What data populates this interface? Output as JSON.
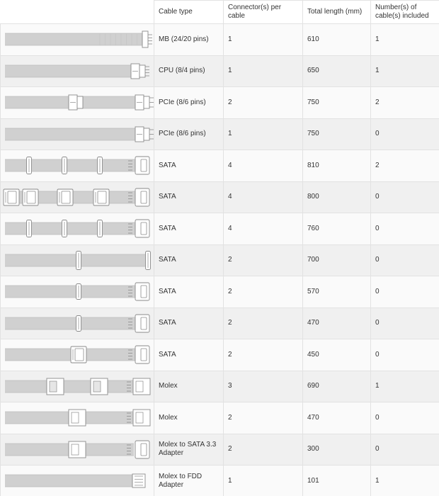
{
  "header": {
    "cable_type": "Cable type",
    "connectors": "Connector(s) per cable",
    "length": "Total length (mm)",
    "included": "Number(s) of cable(s) included"
  },
  "rows": [
    {
      "type": "MB (24/20 pins)",
      "connectors": "1",
      "length": "610",
      "included": "1",
      "diagram": "mb-cable-icon"
    },
    {
      "type": "CPU (8/4 pins)",
      "connectors": "1",
      "length": "650",
      "included": "1",
      "diagram": "cpu-cable-icon"
    },
    {
      "type": "PCIe (8/6 pins)",
      "connectors": "2",
      "length": "750",
      "included": "2",
      "diagram": "pcie-dual-cable-icon"
    },
    {
      "type": "PCIe (8/6 pins)",
      "connectors": "1",
      "length": "750",
      "included": "0",
      "diagram": "pcie-single-cable-icon"
    },
    {
      "type": "SATA",
      "connectors": "4",
      "length": "810",
      "included": "2",
      "diagram": "sata-4-slim-cable-icon"
    },
    {
      "type": "SATA",
      "connectors": "4",
      "length": "800",
      "included": "0",
      "diagram": "sata-4-wide-cable-icon"
    },
    {
      "type": "SATA",
      "connectors": "4",
      "length": "760",
      "included": "0",
      "diagram": "sata-4-slim-cable-icon"
    },
    {
      "type": "SATA",
      "connectors": "2",
      "length": "700",
      "included": "0",
      "diagram": "sata-2-end-slim-cable-icon"
    },
    {
      "type": "SATA",
      "connectors": "2",
      "length": "570",
      "included": "0",
      "diagram": "sata-2-slim-cable-icon"
    },
    {
      "type": "SATA",
      "connectors": "2",
      "length": "470",
      "included": "0",
      "diagram": "sata-2-slim-cable-icon"
    },
    {
      "type": "SATA",
      "connectors": "2",
      "length": "450",
      "included": "0",
      "diagram": "sata-2-wide-cable-icon"
    },
    {
      "type": "Molex",
      "connectors": "3",
      "length": "690",
      "included": "1",
      "diagram": "molex-3-cable-icon"
    },
    {
      "type": "Molex",
      "connectors": "2",
      "length": "470",
      "included": "0",
      "diagram": "molex-2-cable-icon"
    },
    {
      "type": "Molex to SATA 3.3 Adapter",
      "connectors": "2",
      "length": "300",
      "included": "0",
      "diagram": "molex-sata-adapter-icon"
    },
    {
      "type": "Molex to FDD Adapter",
      "connectors": "1",
      "length": "101",
      "included": "1",
      "diagram": "molex-fdd-adapter-icon"
    }
  ]
}
